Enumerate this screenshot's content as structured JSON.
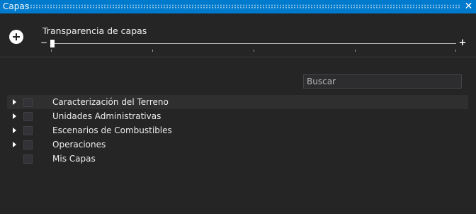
{
  "window": {
    "title": "Capas",
    "close_icon": "close-icon"
  },
  "transparency": {
    "label": "Transparencia de capas",
    "minus": "−",
    "plus": "+",
    "value_fraction": 0.0
  },
  "search": {
    "placeholder": "Buscar",
    "value": ""
  },
  "layers": [
    {
      "label": "Caracterización del Terreno",
      "expandable": true,
      "checked": false,
      "selected": true
    },
    {
      "label": "Unidades Administrativas",
      "expandable": true,
      "checked": false,
      "selected": false
    },
    {
      "label": "Escenarios de Combustibles",
      "expandable": true,
      "checked": false,
      "selected": false
    },
    {
      "label": "Operaciones",
      "expandable": true,
      "checked": false,
      "selected": false
    },
    {
      "label": "Mis Capas",
      "expandable": false,
      "checked": false,
      "selected": false
    }
  ],
  "colors": {
    "accent": "#007acc",
    "background": "#252526"
  }
}
